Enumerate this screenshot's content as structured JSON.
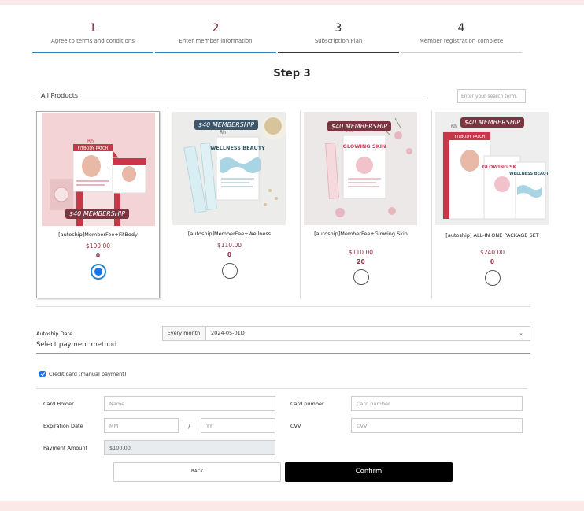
{
  "stepper": {
    "steps": [
      {
        "num": "1",
        "label": "Agree to terms and conditions"
      },
      {
        "num": "2",
        "label": "Enter member information"
      },
      {
        "num": "3",
        "label": "Subscription Plan"
      },
      {
        "num": "4",
        "label": "Member registration complete"
      }
    ],
    "current_step": 3
  },
  "page": {
    "title": "Step 3"
  },
  "products_section": {
    "label": "All Products",
    "search_placeholder": "Enter your search term."
  },
  "products": [
    {
      "name": "[autoship]MemberFee+FitBody",
      "price": "$100.00",
      "qty": "0",
      "badge": "$40 MEMBERSHIP",
      "selected": true
    },
    {
      "name": "[autoship]MemberFee+Wellness",
      "price": "$110.00",
      "qty": "0",
      "badge": "$40 MEMBERSHIP",
      "selected": false
    },
    {
      "name": "[autoship]MemberFee+Glowing Skin",
      "price": "$110.00",
      "qty": "20",
      "badge": "$40 MEMBERSHIP",
      "selected": false
    },
    {
      "name": "[autoship] ALL-IN ONE PACKAGE SET",
      "price": "$240.00",
      "qty": "0",
      "badge": "$40 MEMBERSHIP",
      "selected": false
    }
  ],
  "product_art": {
    "fitbody_box_title": "FITBODY PATCH",
    "wellness_box_title": "WELLNESS BEAUTY",
    "glowing_box_title": "GLOWING SKIN",
    "brand_mark": "Rh"
  },
  "autoship": {
    "label": "Autoship Date",
    "frequency": "Every month",
    "date": "2024-05-01D"
  },
  "payment": {
    "title": "Select payment method",
    "method_label": "Credit card (manual payment)",
    "card_holder_label": "Card Holder",
    "card_holder_placeholder": "Name",
    "card_number_label": "Card number",
    "card_number_placeholder": "Card number",
    "expiration_label": "Expiration Date",
    "mm_placeholder": "MM",
    "slash": "/",
    "yy_placeholder": "YY",
    "cvv_label": "CVV",
    "cvv_placeholder": "CVV",
    "amount_label": "Payment Amount",
    "amount_value": "$100.00"
  },
  "actions": {
    "back_label": "BACK",
    "confirm_label": "Confirm"
  },
  "colors": {
    "accent_maroon": "#7a2b33",
    "step_done_bar": "#2a86c9",
    "radio_selected": "#1a73e8",
    "band_pink": "#fbe9e7"
  }
}
